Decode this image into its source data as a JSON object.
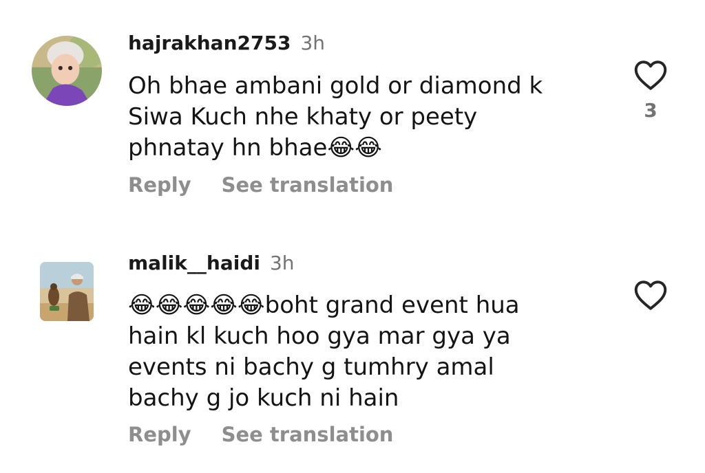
{
  "comments": [
    {
      "username": "hajrakhan2753",
      "time": "3h",
      "text": "Oh bhae ambani gold or diamond k\nSiwa Kuch nhe khaty or peety\nphnatay hn bhae😂😂",
      "reply_label": "Reply",
      "translate_label": "See translation",
      "like_count": "3",
      "avatar_icon": "child-avatar"
    },
    {
      "username": "malik__haidi",
      "time": "3h",
      "text": "😂😂😂😂😂boht grand event hua\nhain kl kuch hoo gya mar gya ya\nevents ni bachy g tumhry amal\nbachy g jo kuch ni hain",
      "reply_label": "Reply",
      "translate_label": "See translation",
      "like_count": "",
      "avatar_icon": "falconer-avatar"
    }
  ],
  "colors": {
    "username": "#1a1a1a",
    "secondary_text": "#8e8e8e",
    "timestamp": "#737373",
    "background": "#ffffff"
  }
}
